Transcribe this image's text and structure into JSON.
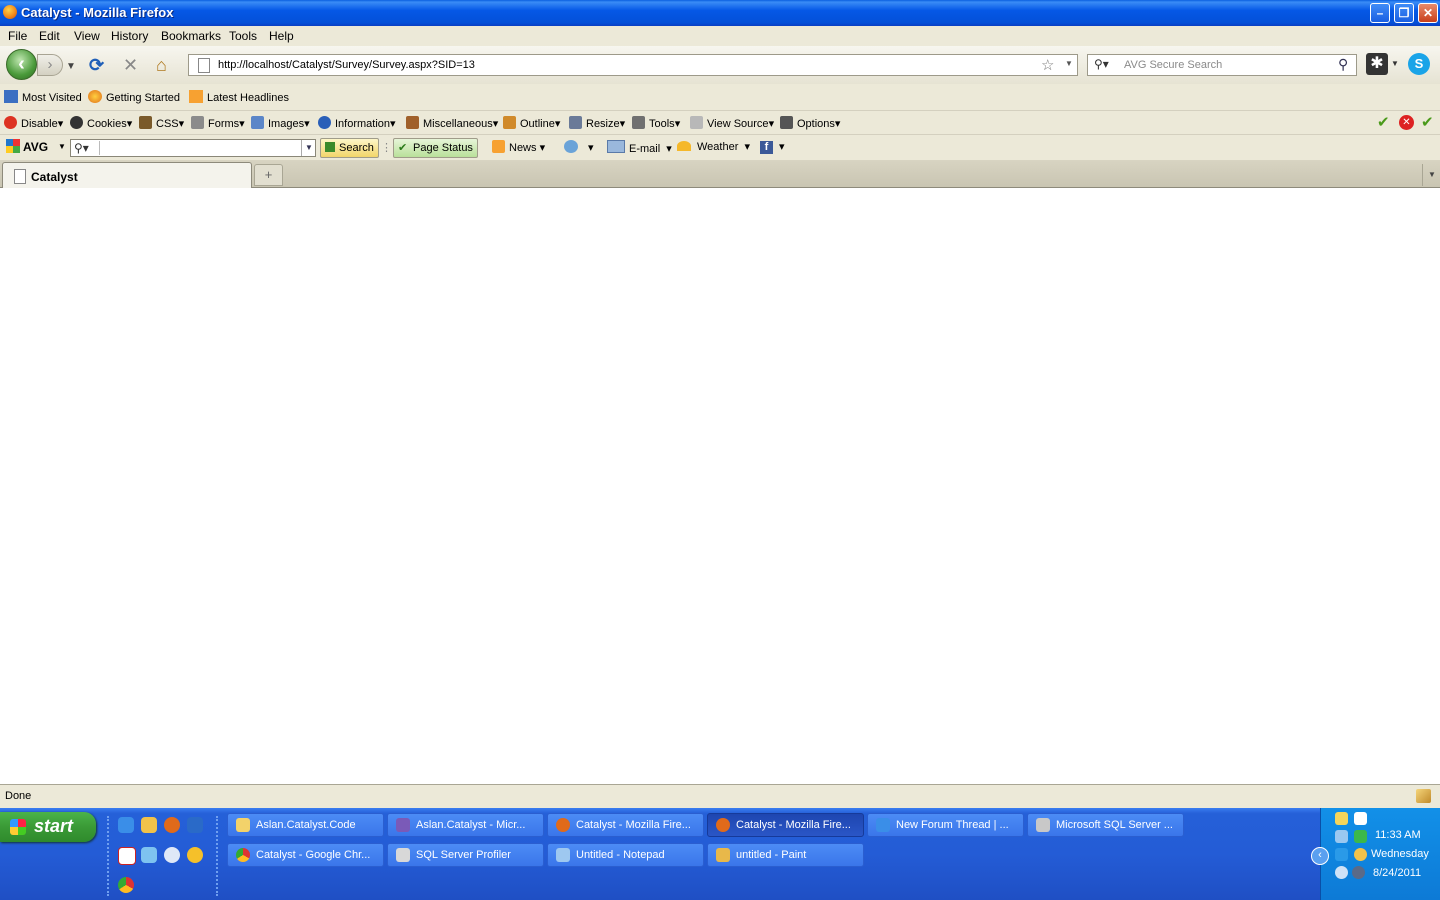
{
  "window": {
    "title": "Catalyst - Mozilla Firefox"
  },
  "menu": [
    "File",
    "Edit",
    "View",
    "History",
    "Bookmarks",
    "Tools",
    "Help"
  ],
  "nav": {
    "url": "http://localhost/Catalyst/Survey/Survey.aspx?SID=13",
    "search_placeholder": "AVG Secure Search"
  },
  "bookmarks": [
    "Most Visited",
    "Getting Started",
    "Latest Headlines"
  ],
  "devtoolbar": [
    "Disable",
    "Cookies",
    "CSS",
    "Forms",
    "Images",
    "Information",
    "Miscellaneous",
    "Outline",
    "Resize",
    "Tools",
    "View Source",
    "Options"
  ],
  "avgbar": {
    "logo": "AVG",
    "search_button": "Search",
    "page_status": "Page Status",
    "news": "News",
    "email": "E-mail",
    "weather": "Weather"
  },
  "tabs": [
    {
      "label": "Catalyst"
    }
  ],
  "status": {
    "text": "Done"
  },
  "taskbar": {
    "start": "start",
    "tasks": [
      "Aslan.Catalyst.Code",
      "Aslan.Catalyst - Micr...",
      "Catalyst - Mozilla Fire...",
      "Catalyst - Mozilla Fire...",
      "New Forum Thread | ...",
      "Microsoft SQL Server ...",
      "Catalyst - Google Chr...",
      "SQL Server Profiler",
      "Untitled - Notepad",
      "untitled - Paint"
    ],
    "clock": {
      "time": "11:33 AM",
      "day": "Wednesday",
      "date": "8/24/2011"
    }
  }
}
